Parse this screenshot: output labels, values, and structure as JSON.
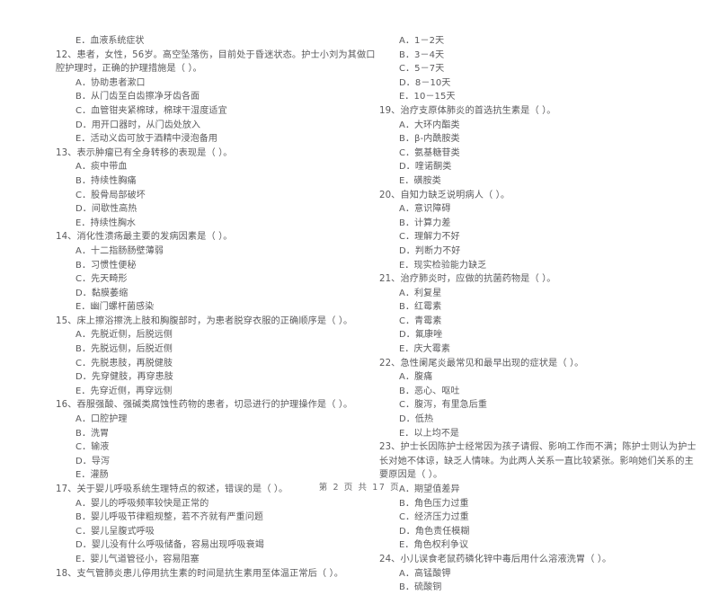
{
  "document": {
    "type": "exam-paper",
    "footer": "第 2 页 共 17 页",
    "page_number": "2",
    "total_pages": "17"
  },
  "left_column": {
    "leading_option": "E．血液系统症状",
    "questions": [
      {
        "stem": "12、患者，女性，56岁。高空坠落伤，目前处于昏迷状态。护士小刘为其做口腔护理时，正确的护理措施是（     ）。",
        "options": [
          "A．协助患者漱口",
          "B．从门齿至白齿擦净牙齿各面",
          "C．血管钳夹紧棉球，棉球干湿度适宜",
          "D．用开口器时，从门齿处放入",
          "E．活动义齿可放于酒精中浸泡备用"
        ]
      },
      {
        "stem": "13、表示肿瘤已有全身转移的表现是（      ）。",
        "options": [
          "A．痰中带血",
          "B．持续性胸痛",
          "C．股骨局部破坏",
          "D．间歇性高热",
          "E．持续性胸水"
        ]
      },
      {
        "stem": "14、消化性溃疡最主要的发病因素是（     ）。",
        "options": [
          "A．十二指肠肠壁薄弱",
          "B．习惯性便秘",
          "C．先天畸形",
          "D．黏膜萎缩",
          "E．幽门螺杆菌感染"
        ]
      },
      {
        "stem": "15、床上擦浴擦洗上肢和胸腹部时，为患者脱穿衣服的正确顺序是（     ）。",
        "options": [
          "A．先脱近侧，后脱远侧",
          "B．先脱远侧，后脱近侧",
          "C．先脱患肢，再脱健肢",
          "D．先穿健肢，再穿患肢",
          "E．先穿近侧，再穿远侧"
        ]
      },
      {
        "stem": "16、吞服强酸、强碱类腐蚀性药物的患者，切忌进行的护理操作是（     ）。",
        "options": [
          "A．口腔护理",
          "B．洗胃",
          "C．输液",
          "D．导泻",
          "E．灌肠"
        ]
      },
      {
        "stem": "17、关于婴儿呼吸系统生理特点的叙述，错误的是（     ）。",
        "options": [
          "A．婴儿的呼吸频率较快是正常的",
          "B．婴儿呼吸节律粗规整，若不齐就有严重问题",
          "C．婴儿呈腹式呼吸",
          "D．婴儿没有什么呼吸储备，容易出现呼吸衰竭",
          "E．婴儿气道管径小，容易阻塞"
        ]
      },
      {
        "stem": "18、支气管肺炎患儿停用抗生素的时间是抗生素用至体温正常后（     ）。",
        "options": []
      }
    ]
  },
  "right_column": {
    "leading_options": [
      "A．1－2天",
      "B．3－4天",
      "C．5－7天",
      "D．8－10天",
      "E．10－15天"
    ],
    "questions": [
      {
        "stem": "19、治疗支原体肺炎的首选抗生素是（     ）。",
        "options": [
          "A．大环内酯类",
          "B．β-内酰胺类",
          "C．氨基糖苷类",
          "D．喹诺酮类",
          "E．磺胺类"
        ]
      },
      {
        "stem": "20、自知力缺乏说明病人（     ）。",
        "options": [
          "A．意识障碍",
          "B．计算力差",
          "C．理解力不好",
          "D．判断力不好",
          "E．现实检验能力缺乏"
        ]
      },
      {
        "stem": "21、治疗肺炎时，应做的抗菌药物是（     ）。",
        "options": [
          "A．利复星",
          "B．红霉素",
          "C．青霉素",
          "D．氟康唑",
          "E．庆大霉素"
        ]
      },
      {
        "stem": "22、急性阑尾炎最常见和最早出现的症状是（     ）。",
        "options": [
          "A．腹痛",
          "B．恶心、呕吐",
          "C．腹泻，有里急后重",
          "D．低热",
          "E．以上均不是"
        ]
      },
      {
        "stem": "23、护士长因陈护士经常因为孩子请假、影响工作而不满；陈护士则认为护士长对她不体谅，缺乏人情味。为此两人关系一直比较紧张。影响她们关系的主要原因是（     ）。",
        "options": [
          "A．期望值差异",
          "B．角色压力过重",
          "C．经济压力过重",
          "D．角色责任模糊",
          "E．角色权利争议"
        ]
      },
      {
        "stem": "24、小儿误食老鼠药磷化锌中毒后用什么溶液洗胃（     ）。",
        "options": [
          "A．高锰酸钾",
          "B．硫酸铜"
        ]
      }
    ]
  }
}
